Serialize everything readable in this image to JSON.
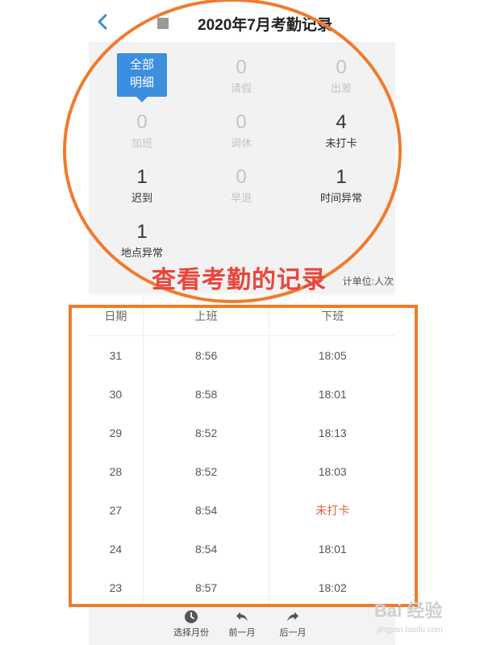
{
  "header": {
    "title": "2020年7月考勤记录"
  },
  "summary": {
    "tip_line1": "全部",
    "tip_line2": "明细",
    "stats": [
      {
        "value": "0",
        "label": "请假"
      },
      {
        "value": "0",
        "label": "出差"
      },
      {
        "value": "0",
        "label": "加班"
      },
      {
        "value": "0",
        "label": "调休"
      },
      {
        "value": "4",
        "label": "未打卡"
      },
      {
        "value": "1",
        "label": "迟到"
      },
      {
        "value": "0",
        "label": "早退"
      },
      {
        "value": "1",
        "label": "时间异常"
      },
      {
        "value": "1",
        "label": "地点异常"
      }
    ],
    "unit": "计单位:人次"
  },
  "annotation": "查看考勤的记录",
  "table": {
    "headers": [
      "日期",
      "上班",
      "下班"
    ],
    "rows": [
      [
        "31",
        "8:56",
        "18:05"
      ],
      [
        "30",
        "8:58",
        "18:01"
      ],
      [
        "29",
        "8:52",
        "18:13"
      ],
      [
        "28",
        "8:52",
        "18:03"
      ],
      [
        "27",
        "8:54",
        "未打卡"
      ],
      [
        "24",
        "8:54",
        "18:01"
      ],
      [
        "23",
        "8:57",
        "18:02"
      ]
    ]
  },
  "bottom_nav": [
    {
      "label": "选择月份",
      "icon": "clock-icon"
    },
    {
      "label": "前一月",
      "icon": "arrow-left-icon"
    },
    {
      "label": "后一月",
      "icon": "arrow-right-icon"
    }
  ],
  "watermark": {
    "logo": "Bai 经验",
    "url": "jingyan.baidu.com"
  },
  "colors": {
    "accent": "#3c8ede",
    "highlight": "#f07b2c",
    "annotation": "#e8463c",
    "missing": "#e0623c"
  }
}
